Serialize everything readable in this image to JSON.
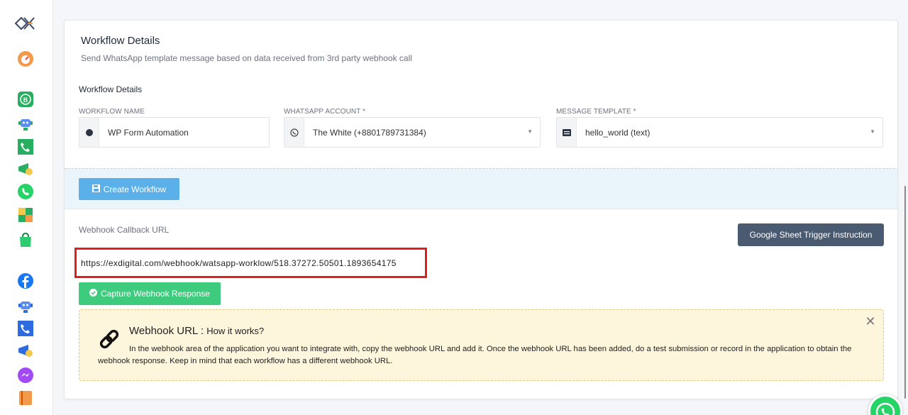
{
  "sidebar": {
    "items": [
      {
        "name": "dashboard",
        "color": "#f2994a"
      },
      {
        "name": "whatsapp-business",
        "color": "#27ae60"
      },
      {
        "name": "bot",
        "color": "#5b8def"
      },
      {
        "name": "call",
        "color": "#27ae60"
      },
      {
        "name": "campaign",
        "color": "#f2c94c"
      },
      {
        "name": "whatsapp",
        "color": "#25d366"
      },
      {
        "name": "puzzle",
        "color": "#f2994a"
      },
      {
        "name": "shop",
        "color": "#2ecc71"
      },
      {
        "name": "facebook",
        "color": "#1877f2"
      },
      {
        "name": "messenger-bot",
        "color": "#5b8def"
      },
      {
        "name": "phone",
        "color": "#2d6cdf"
      },
      {
        "name": "broadcast",
        "color": "#2d6cdf"
      },
      {
        "name": "messenger",
        "color": "#a24bf4"
      },
      {
        "name": "book",
        "color": "#f2994a"
      }
    ]
  },
  "card": {
    "title": "Workflow Details",
    "subtitle": "Send WhatsApp template message based on data received from 3rd party webhook call",
    "section_title": "Workflow Details"
  },
  "fields": {
    "workflow_name": {
      "label": "WORKFLOW NAME",
      "value": "WP Form Automation"
    },
    "whatsapp_account": {
      "label": "WHATSAPP ACCOUNT *",
      "value": "The White (+8801789731384)"
    },
    "message_template": {
      "label": "MESSAGE TEMPLATE *",
      "value": "hello_world (text)"
    }
  },
  "buttons": {
    "create_workflow": "Create Workflow",
    "google_sheet": "Google Sheet Trigger Instruction",
    "capture_webhook": "Capture Webhook Response"
  },
  "webhook": {
    "label": "Webhook Callback URL",
    "url": "https://exdigital.com/webhook/watsapp-worklow/518.37272.50501.1893654175"
  },
  "info": {
    "title": "Webhook URL :",
    "title_sub": "How it works?",
    "text": "In the webhook area of the application you want to integrate with, copy the webhook URL and add it. Once the webhook URL has been added, do a test submission or record in the application to obtain the webhook response. Keep in mind that each workflow has a different webhook URL."
  },
  "colors": {
    "accent_blue": "#5cb0ea",
    "success_green": "#3ecb7e",
    "dark_button": "#4a5a70",
    "highlight_red": "#e01e1e",
    "info_bg": "#fdf5dc"
  }
}
